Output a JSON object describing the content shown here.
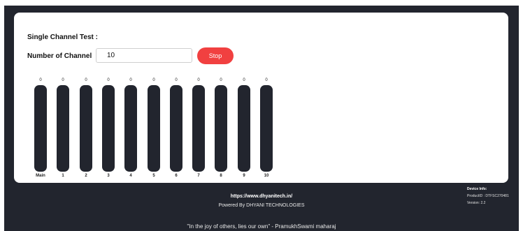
{
  "test": {
    "title": "Single Channel Test :",
    "number_label": "Number of Channel",
    "number_value": "10",
    "stop_label": "Stop"
  },
  "channels": [
    {
      "label": "Main",
      "value": "0",
      "level": 0
    },
    {
      "label": "1",
      "value": "0",
      "level": 0
    },
    {
      "label": "2",
      "value": "0",
      "level": 0
    },
    {
      "label": "3",
      "value": "0",
      "level": 0
    },
    {
      "label": "4",
      "value": "0",
      "level": 0
    },
    {
      "label": "5",
      "value": "0",
      "level": 0
    },
    {
      "label": "6",
      "value": "0",
      "level": 0
    },
    {
      "label": "7",
      "value": "0",
      "level": 0
    },
    {
      "label": "8",
      "value": "0",
      "level": 0
    },
    {
      "label": "9",
      "value": "0",
      "level": 0
    },
    {
      "label": "10",
      "value": "0",
      "level": 0
    }
  ],
  "footer": {
    "url": "https://www.dhyanitech.in/",
    "powered": "Powered By DHYANI TECHNOLOGIES",
    "quote": "\"In the joy of others, lies our own\" - PramukhSwami maharaj"
  },
  "device": {
    "heading": "Device Info:",
    "product": "ProductID : DTFSC270481",
    "version": "Version: 2.2"
  },
  "colors": {
    "dark": "#22252e",
    "stop": "#f14040",
    "fill": "#2ecc71"
  }
}
